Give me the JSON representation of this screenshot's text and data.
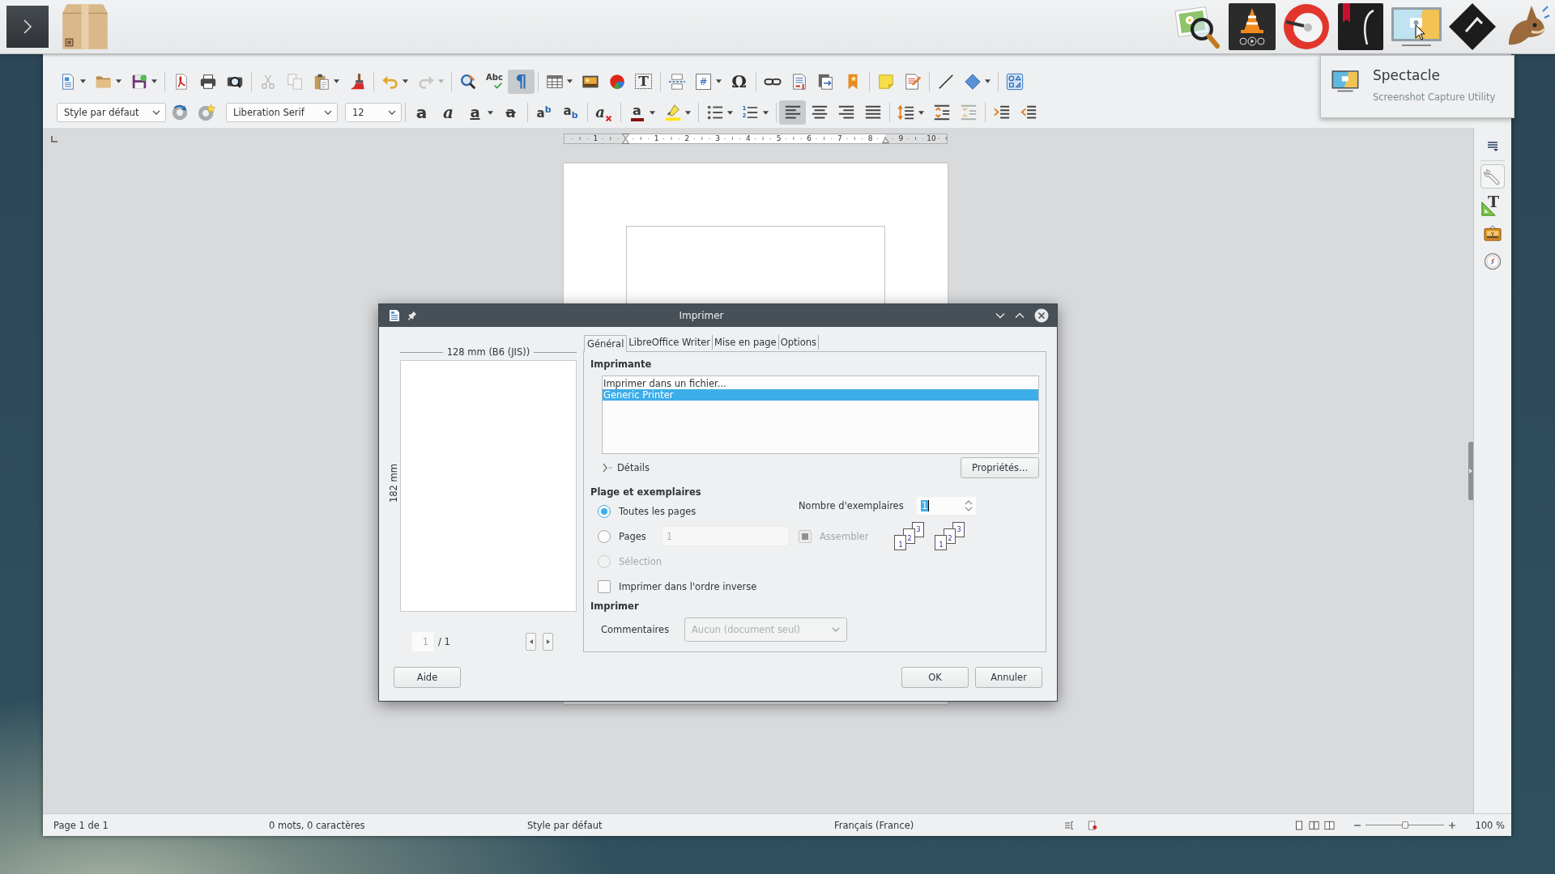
{
  "tooltip": {
    "title": "Spectacle",
    "subtitle": "Screenshot Capture Utility"
  },
  "standard_toolbar": {
    "groups": [
      [
        {
          "kind": "new",
          "dropdown": true,
          "on": false,
          "disabled": false
        },
        {
          "kind": "open",
          "dropdown": true,
          "on": false,
          "disabled": false
        },
        {
          "kind": "save",
          "dropdown": true,
          "on": false,
          "disabled": false
        }
      ],
      [
        {
          "kind": "pdf",
          "dropdown": false,
          "on": false,
          "disabled": false
        },
        {
          "kind": "print",
          "dropdown": false,
          "on": false,
          "disabled": false
        },
        {
          "kind": "preview",
          "dropdown": false,
          "on": false,
          "disabled": false
        }
      ],
      [
        {
          "kind": "cut",
          "dropdown": false,
          "on": false,
          "disabled": true
        },
        {
          "kind": "copy",
          "dropdown": false,
          "on": false,
          "disabled": true
        },
        {
          "kind": "paste",
          "dropdown": true,
          "on": false,
          "disabled": false
        },
        {
          "kind": "clone",
          "dropdown": false,
          "on": false,
          "disabled": false
        }
      ],
      [
        {
          "kind": "undo",
          "dropdown": true,
          "on": false,
          "disabled": false
        },
        {
          "kind": "redo",
          "dropdown": true,
          "on": false,
          "disabled": true
        }
      ],
      [
        {
          "kind": "find",
          "dropdown": false,
          "on": false,
          "disabled": false
        },
        {
          "kind": "spelling",
          "glyph": "Abc",
          "dropdown": false,
          "on": false,
          "disabled": false
        },
        {
          "kind": "marks",
          "glyph": "¶",
          "dropdown": false,
          "on": true,
          "disabled": false
        }
      ],
      [
        {
          "kind": "table",
          "dropdown": true,
          "on": false,
          "disabled": false
        },
        {
          "kind": "image",
          "dropdown": false,
          "on": false,
          "disabled": false
        },
        {
          "kind": "chart",
          "dropdown": false,
          "on": false,
          "disabled": false
        },
        {
          "kind": "textbox",
          "glyph": "T",
          "dropdown": false,
          "on": false,
          "disabled": false
        }
      ],
      [
        {
          "kind": "pagebreak",
          "dropdown": false,
          "on": false,
          "disabled": false
        },
        {
          "kind": "field",
          "glyph": "#",
          "dropdown": true,
          "on": false,
          "disabled": false
        },
        {
          "kind": "special",
          "glyph": "Ω",
          "dropdown": false,
          "on": false,
          "disabled": false
        }
      ],
      [
        {
          "kind": "link",
          "dropdown": false,
          "on": false,
          "disabled": false
        },
        {
          "kind": "footnote",
          "dropdown": false,
          "on": false,
          "disabled": false
        },
        {
          "kind": "endnote",
          "dropdown": false,
          "on": false,
          "disabled": false
        },
        {
          "kind": "bookmark",
          "dropdown": false,
          "on": false,
          "disabled": false
        }
      ],
      [
        {
          "kind": "comment",
          "dropdown": false,
          "on": false,
          "disabled": false
        },
        {
          "kind": "track",
          "dropdown": false,
          "on": false,
          "disabled": false
        }
      ],
      [
        {
          "kind": "line",
          "dropdown": false,
          "on": false,
          "disabled": false
        },
        {
          "kind": "shapes",
          "dropdown": true,
          "on": false,
          "disabled": false
        }
      ],
      [
        {
          "kind": "draw",
          "dropdown": false,
          "on": false,
          "disabled": false
        }
      ]
    ]
  },
  "formatting_toolbar": {
    "groups": [
      [
        {
          "kind": "style_box",
          "value": "Style par défaut"
        },
        {
          "kind": "update_style",
          "dropdown": false,
          "on": false,
          "disabled": false
        },
        {
          "kind": "new_style",
          "dropdown": false,
          "on": false,
          "disabled": false
        },
        {
          "kind": "font_box",
          "value": "Liberation Serif"
        },
        {
          "kind": "size_box",
          "value": "12"
        }
      ],
      [
        {
          "kind": "bold",
          "glyph": "a",
          "dropdown": false,
          "on": false,
          "disabled": false
        },
        {
          "kind": "italic",
          "glyph": "a",
          "dropdown": false,
          "on": false,
          "disabled": false
        },
        {
          "kind": "underline",
          "glyph": "a",
          "dropdown": true,
          "on": false,
          "disabled": false
        },
        {
          "kind": "strike",
          "glyph": "a",
          "dropdown": false,
          "on": false,
          "disabled": false
        }
      ],
      [
        {
          "kind": "superscript",
          "glyph": "a$^{b}$",
          "dropdown": false,
          "on": false,
          "disabled": false
        },
        {
          "kind": "subscript",
          "glyph": "a$_{b}$",
          "dropdown": false,
          "on": false,
          "disabled": false
        }
      ],
      [
        {
          "kind": "clear",
          "glyph": "a",
          "dropdown": false,
          "on": false,
          "disabled": false
        }
      ],
      [
        {
          "kind": "font_color",
          "glyph": "a",
          "dropdown": true,
          "on": false,
          "disabled": false
        },
        {
          "kind": "highlight",
          "dropdown": true,
          "on": false,
          "disabled": false
        }
      ],
      [
        {
          "kind": "bullets",
          "dropdown": true,
          "on": false,
          "disabled": false
        },
        {
          "kind": "numbering",
          "glyph": "1\n2",
          "dropdown": true,
          "on": false,
          "disabled": false
        }
      ],
      [
        {
          "kind": "align_left",
          "dropdown": false,
          "on": true,
          "disabled": false
        },
        {
          "kind": "align_center",
          "dropdown": false,
          "on": false,
          "disabled": false
        },
        {
          "kind": "align_right",
          "dropdown": false,
          "on": false,
          "disabled": false
        },
        {
          "kind": "justify",
          "dropdown": false,
          "on": false,
          "disabled": false
        }
      ],
      [
        {
          "kind": "line_spacing",
          "dropdown": true,
          "on": false,
          "disabled": false
        },
        {
          "kind": "para_up",
          "dropdown": false,
          "on": false,
          "disabled": false
        },
        {
          "kind": "para_down",
          "dropdown": false,
          "on": false,
          "disabled": true
        }
      ],
      [
        {
          "kind": "indent",
          "dropdown": false,
          "on": false,
          "disabled": false
        },
        {
          "kind": "outdent",
          "dropdown": false,
          "on": false,
          "disabled": false
        }
      ]
    ]
  },
  "ruler": {
    "left_labels": [
      "1"
    ],
    "right_labels": [
      "1",
      "2",
      "3",
      "4",
      "5",
      "6",
      "7",
      "8",
      "9",
      "10"
    ]
  },
  "sidebar": {
    "decks": [
      {
        "kind": "properties",
        "selected": true
      },
      {
        "kind": "styles",
        "glyph": "T",
        "selected": false
      },
      {
        "kind": "gallery",
        "selected": false
      },
      {
        "kind": "navigator",
        "selected": false
      }
    ]
  },
  "status_bar": {
    "page": "Page 1 de 1",
    "words": "0 mots, 0 caractères",
    "style": "Style par défaut",
    "language": "Français (France)",
    "zoom": {
      "level": 0.5,
      "label": "100 %"
    }
  },
  "print_dialog": {
    "title": "Imprimer",
    "preview": {
      "width_label": "128 mm (B6 (JIS))",
      "height_label": "182 mm",
      "page": "1",
      "page_total": "/ 1"
    },
    "tabs": [
      {
        "label": "Général",
        "selected": true
      },
      {
        "label": "LibreOffice Writer",
        "selected": false
      },
      {
        "label": "Mise en page",
        "selected": false
      },
      {
        "label": "Options",
        "selected": false
      }
    ],
    "printer": {
      "heading": "Imprimante",
      "printers": [
        {
          "name": "Imprimer dans un fichier...",
          "selected": false
        },
        {
          "name": "Generic Printer",
          "selected": true
        }
      ],
      "details": {
        "label": "Détails",
        "expanded": false
      },
      "properties_button": "Propriétés..."
    },
    "range": {
      "heading": "Plage et exemplaires",
      "options": [
        {
          "label": "Toutes les pages",
          "selected": true,
          "disabled": false
        },
        {
          "label": "Pages",
          "selected": false,
          "disabled": false,
          "field": {
            "value": "1",
            "disabled": true
          }
        },
        {
          "label": "Sélection",
          "selected": false,
          "disabled": true
        }
      ],
      "reverse": {
        "label": "Imprimer dans l'ordre inverse",
        "checked": false
      },
      "copies": {
        "label": "Nombre d'exemplaires",
        "value": "1",
        "focused": true
      },
      "collate": {
        "label": "Assembler",
        "checked": true,
        "disabled": true
      },
      "collate_icons": [
        {
          "pages": [
            "1",
            "2",
            "3"
          ]
        },
        {
          "pages": [
            "1",
            "2",
            "3"
          ]
        }
      ]
    },
    "print": {
      "heading": "Imprimer",
      "comments": {
        "label": "Commentaires",
        "value": "Aucun (document seul)",
        "disabled": true
      }
    },
    "buttons": {
      "help": "Aide",
      "ok": "OK",
      "cancel": "Annuler"
    }
  }
}
